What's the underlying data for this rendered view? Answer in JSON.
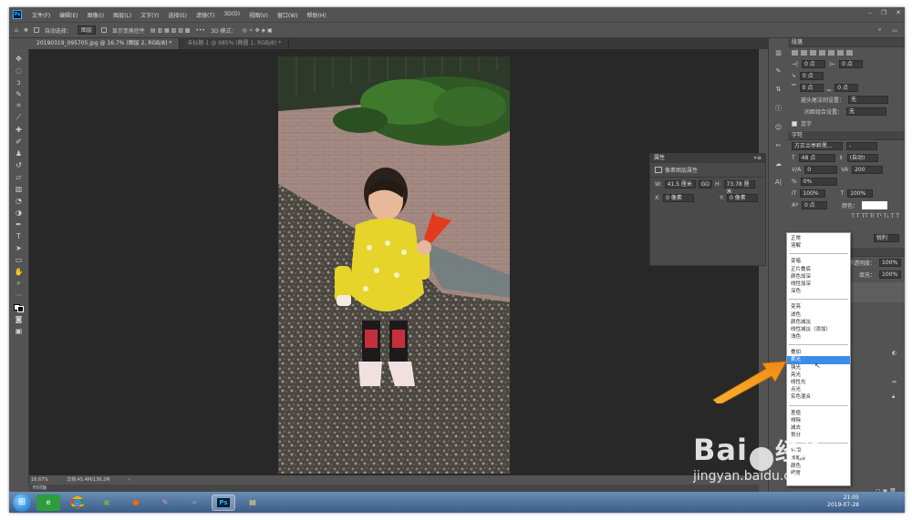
{
  "app": {
    "logo": "Ps"
  },
  "menu": [
    "文件(F)",
    "编辑(E)",
    "图像(I)",
    "图层(L)",
    "文字(Y)",
    "选择(S)",
    "滤镜(T)",
    "3D(D)",
    "视图(V)",
    "窗口(W)",
    "帮助(H)"
  ],
  "options": {
    "auto_select_label": "自动选择：",
    "auto_select_value": "图层",
    "show_transform": "显示变换控件",
    "mode_label": "3D 模式："
  },
  "tabs": [
    "20190319_095705.jpg @ 16.7% (图层 2, RGB/8) *",
    "未标题-1 @ 985% (椭圆 1, RGB/8) *"
  ],
  "status": {
    "zoom": "16.67%",
    "doc": "文档:45.4M/136.2M",
    "timeline": "时间轴"
  },
  "properties": {
    "title": "属性",
    "subtitle": "像素图层属性",
    "w_label": "W:",
    "w": "41.5 厘米",
    "link": "GO",
    "h_label": "H:",
    "h": "73.78 厘米",
    "x_label": "X:",
    "x": "0 像素",
    "y_label": "Y:",
    "y": "0 像素"
  },
  "paragraph": {
    "title": "段落",
    "indent1": "0 点",
    "indent2": "0 点",
    "indent3": "0 点",
    "space_before": "0 点",
    "space_after": "0 点",
    "rule_label": "避头尾法则设置：",
    "rule_value": "无",
    "compose_label": "间距组合设置：",
    "compose_value": "无",
    "hyphen": "连字"
  },
  "character": {
    "title": "字符",
    "font": "方正兰亭粹黑...",
    "size": "48 点",
    "leading": "(自动)",
    "tracking_v": "0",
    "tracking": "200",
    "scale_percent": "0%",
    "vscale": "100%",
    "hscale": "100%",
    "baseline": "0 点",
    "color_label": "颜色：",
    "aa": "锐利"
  },
  "layers": {
    "opacity_label": "不透明度：",
    "opacity": "100%",
    "fill_label": "填充：",
    "fill": "100%"
  },
  "blend_modes": [
    [
      "正常",
      "溶解"
    ],
    [
      "变暗",
      "正片叠底",
      "颜色加深",
      "线性加深",
      "深色"
    ],
    [
      "变亮",
      "滤色",
      "颜色减淡",
      "线性减淡（添加）",
      "浅色"
    ],
    [
      "叠加",
      "柔光",
      "强光",
      "亮光",
      "线性光",
      "点光",
      "实色混合"
    ],
    [
      "差值",
      "排除",
      "减去",
      "划分"
    ],
    [
      "色相",
      "饱和度",
      "颜色",
      "明度"
    ]
  ],
  "selected_blend": "柔光",
  "tray": {
    "time": "21:05",
    "date": "2019-07-28"
  },
  "watermark": {
    "brand": "Bai",
    "brand2": "经验",
    "url": "jingyan.baidu.com"
  },
  "colors": {
    "accent": "#3a8ee6",
    "arrow": "#f39c12"
  }
}
